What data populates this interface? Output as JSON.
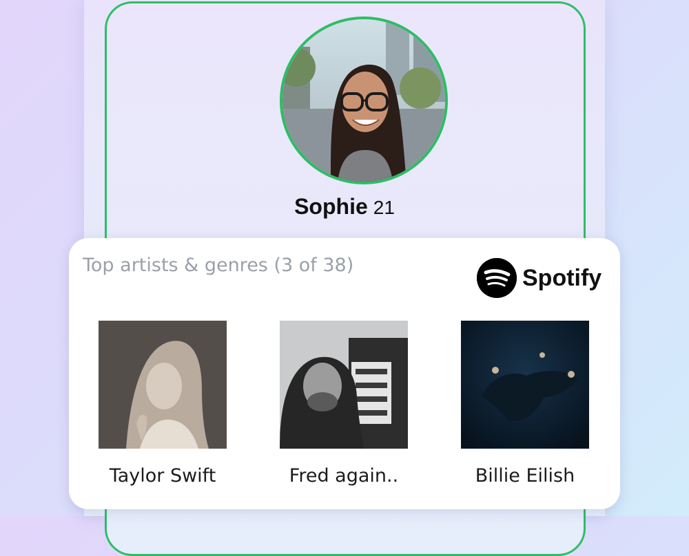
{
  "profile": {
    "name": "Sophie",
    "age": "21",
    "avatar_icon": "profile-photo",
    "accent_color": "#2ebd66"
  },
  "music": {
    "title": "Top artists & genres (3 of 38)",
    "provider": {
      "name": "Spotify",
      "icon": "spotify-logo-icon"
    },
    "artists": [
      {
        "name": "Taylor Swift"
      },
      {
        "name": "Fred again.."
      },
      {
        "name": "Billie Eilish"
      }
    ]
  }
}
